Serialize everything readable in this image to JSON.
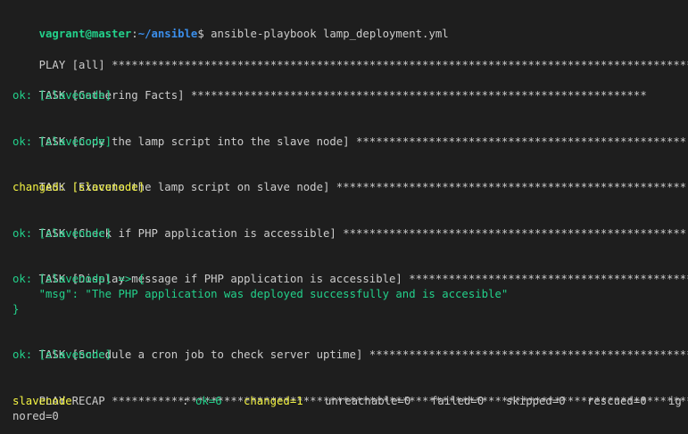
{
  "prompt": {
    "user_host": "vagrant@master",
    "separator": ":",
    "path": "~/ansible",
    "symbol": "$",
    "command": " ansible-playbook lamp_deployment.yml"
  },
  "play": {
    "header": "PLAY [all] ",
    "stars": "*****************************************************************************************"
  },
  "tasks": [
    {
      "header": "TASK [Gathering Facts] ",
      "stars": "*********************************************************************",
      "result": "ok: [slavenode]"
    },
    {
      "header": "TASK [Copy the lamp script into the slave node] ",
      "stars": "**************************************************",
      "result": "ok: [slavenode]"
    },
    {
      "header": "TASK [Execute the lamp script on slave node] ",
      "stars": "*****************************************************",
      "result": "changed: [slavenode]"
    },
    {
      "header": "TASK [Check if PHP application is accessible] ",
      "stars": "****************************************************",
      "result": "ok: [slavenode]"
    },
    {
      "header": "TASK [Display message if PHP application is accessible] ",
      "stars": "*******************************************",
      "result": "ok: [slavenode] => {",
      "msg_line": "    \"msg\": \"The PHP application was deployed successfully and is accesible\"",
      "close": "}"
    },
    {
      "header": "TASK [Schedule a cron job to check server uptime] ",
      "stars": "*************************************************",
      "result": "ok: [slavenode]"
    }
  ],
  "recap": {
    "header": "PLAY RECAP ",
    "stars": "*****************************************************************************************",
    "host": "slavenode",
    "colon": ":",
    "ok": "ok=6",
    "changed": "changed=1",
    "unreachable": "unreachable=0",
    "failed": "failed=0",
    "skipped": "skipped=0",
    "rescued": "rescued=0",
    "ignored_part1": "ig",
    "ignored_part2": "nored=0"
  },
  "colors": {
    "background": "#1e1e1e",
    "ok_green": "#23d18b",
    "changed_yellow": "#f5f543",
    "path_blue": "#3b8eea",
    "text": "#cccccc"
  }
}
